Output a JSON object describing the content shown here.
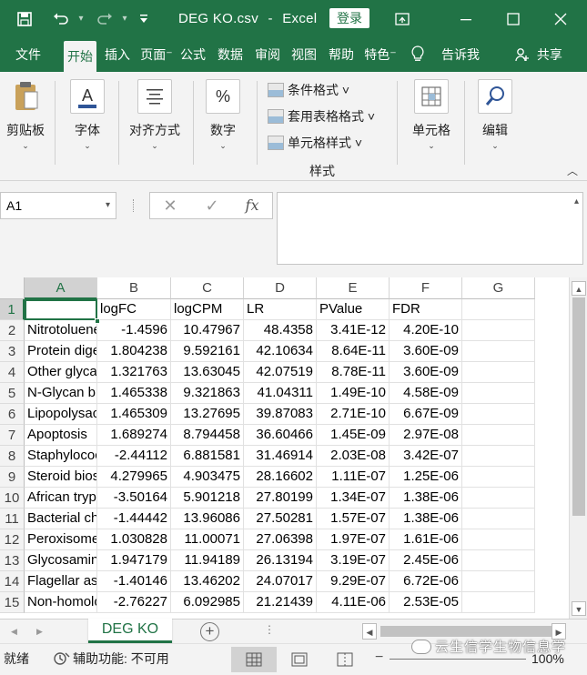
{
  "app": {
    "doc_title": "DEG KO.csv",
    "sep": "-",
    "app_name": "Excel",
    "login_label": "登录"
  },
  "tabs": [
    {
      "label": "文件",
      "active": false
    },
    {
      "label": "开始",
      "active": true
    },
    {
      "label": "插入",
      "active": false
    },
    {
      "label": "页面⁻",
      "active": false
    },
    {
      "label": "公式",
      "active": false
    },
    {
      "label": "数据",
      "active": false
    },
    {
      "label": "审阅",
      "active": false
    },
    {
      "label": "视图",
      "active": false
    },
    {
      "label": "帮助",
      "active": false
    },
    {
      "label": "特色⁻",
      "active": false
    }
  ],
  "tell_me": "告诉我",
  "share": "共享",
  "ribbon": {
    "clipboard": "剪贴板",
    "font": "字体",
    "alignment": "对齐方式",
    "number": "数字",
    "conditional_format": "条件格式 ˅",
    "table_format": "套用表格格式 ˅",
    "cell_styles": "单元格样式 ˅",
    "styles_group": "样式",
    "cells": "单元格",
    "editing": "编辑",
    "number_icon_text": "%"
  },
  "formula_bar": {
    "name_box": "A1",
    "cancel": "✕",
    "enter": "✓",
    "fx": "fx",
    "value": ""
  },
  "grid": {
    "columns": [
      "A",
      "B",
      "C",
      "D",
      "E",
      "F",
      "G"
    ],
    "row_numbers": [
      "1",
      "2",
      "3",
      "4",
      "5",
      "6",
      "7",
      "8",
      "9",
      "10",
      "11",
      "12",
      "13",
      "14",
      "15"
    ],
    "header_row": [
      "",
      "logFC",
      "logCPM",
      "LR",
      "PValue",
      "FDR",
      ""
    ],
    "rows": [
      [
        "Nitrotoluene degradation",
        "-1.4596",
        "10.47967",
        "48.4358",
        "3.41E-12",
        "4.20E-10"
      ],
      [
        "Protein digestion and absorption",
        "1.804238",
        "9.592161",
        "42.10634",
        "8.64E-11",
        "3.60E-09"
      ],
      [
        "Other glycan degradation",
        "1.321763",
        "13.63045",
        "42.07519",
        "8.78E-11",
        "3.60E-09"
      ],
      [
        "N-Glycan biosynthesis",
        "1.465338",
        "9.321863",
        "41.04311",
        "1.49E-10",
        "4.58E-09"
      ],
      [
        "Lipopolysaccharide biosynthesis",
        "1.465309",
        "13.27695",
        "39.87083",
        "2.71E-10",
        "6.67E-09"
      ],
      [
        "Apoptosis",
        "1.689274",
        "8.794458",
        "36.60466",
        "1.45E-09",
        "2.97E-08"
      ],
      [
        "Staphylococcus aureus infection",
        "-2.44112",
        "6.881581",
        "31.46914",
        "2.03E-08",
        "3.42E-07"
      ],
      [
        "Steroid biosynthesis",
        "4.279965",
        "4.903475",
        "28.16602",
        "1.11E-07",
        "1.25E-06"
      ],
      [
        "African trypanosomiasis",
        "-3.50164",
        "5.901218",
        "27.80199",
        "1.34E-07",
        "1.38E-06"
      ],
      [
        "Bacterial chemotaxis",
        "-1.44442",
        "13.96086",
        "27.50281",
        "1.57E-07",
        "1.38E-06"
      ],
      [
        "Peroxisome",
        "1.030828",
        "11.00071",
        "27.06398",
        "1.97E-07",
        "1.61E-06"
      ],
      [
        "Glycosaminoglycan degradation",
        "1.947179",
        "11.94189",
        "26.13194",
        "3.19E-07",
        "2.45E-06"
      ],
      [
        "Flagellar assembly",
        "-1.40146",
        "13.46202",
        "24.07017",
        "9.29E-07",
        "6.72E-06"
      ],
      [
        "Non-homologous end-joining",
        "-2.76227",
        "6.092985",
        "21.21439",
        "4.11E-06",
        "2.53E-05"
      ]
    ]
  },
  "sheet_tab": "DEG KO",
  "add_sheet": "+",
  "status": {
    "ready": "就绪",
    "accessibility": "辅助功能: 不可用",
    "zoom": "100%",
    "zoom_minus": "−"
  },
  "watermark": "云生信学生物信息学",
  "colors": {
    "brand_green": "#217346",
    "ribbon_bg": "#f3f3f3",
    "gridline": "#e1e1e1"
  },
  "icons": {
    "save": "save-icon",
    "undo": "undo-icon",
    "redo": "redo-icon",
    "bulb": "lightbulb-icon",
    "share": "person-add-icon"
  }
}
